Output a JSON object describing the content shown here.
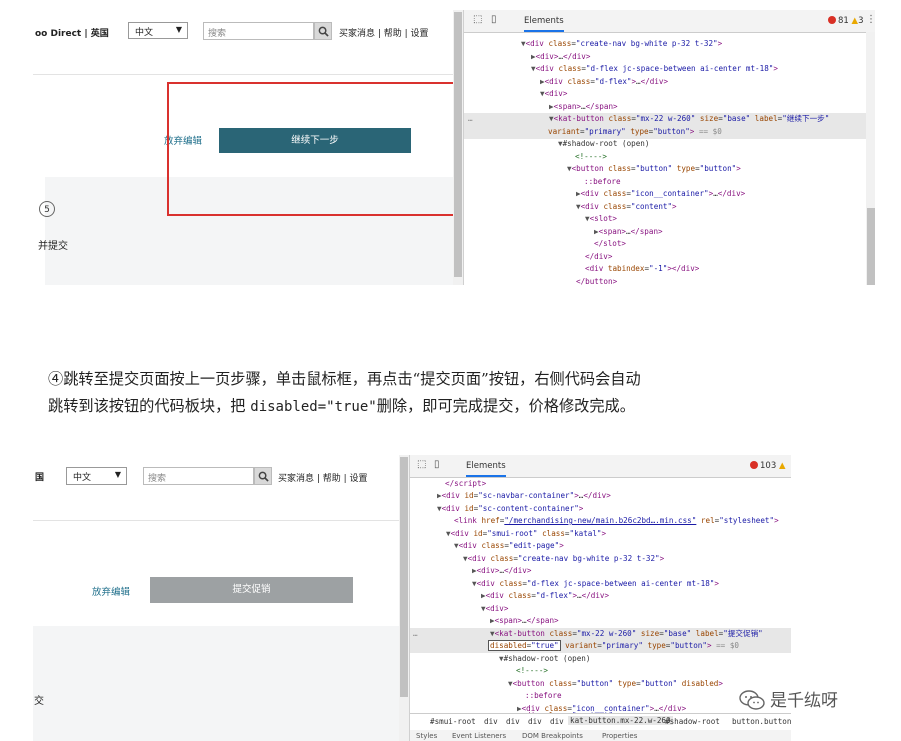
{
  "shot1": {
    "header": {
      "site": "oo Direct | 英国",
      "language": "中文",
      "search_placeholder": "搜索",
      "search_icon": "magnifier-icon",
      "links": "买家消息 | 帮助 | 设置"
    },
    "discard_label": "放弃编辑",
    "continue_label": "继续下一步",
    "step_badge": "5",
    "submit_fragment": "并提交",
    "devtools": {
      "tab": "Elements",
      "error_count": "81",
      "warning_count": "3",
      "close": "×",
      "more": "⋮"
    }
  },
  "shot2": {
    "header": {
      "site": "国",
      "language": "中文",
      "search_placeholder": "搜索",
      "search_icon": "magnifier-icon",
      "links": "买家消息 | 帮助 | 设置"
    },
    "discard_label": "放弃编辑",
    "submit_label": "提交促销",
    "side_fragment": "交",
    "devtools": {
      "tab": "Elements",
      "error_count": "103",
      "breadcrumbs": [
        "#smui-root",
        "div",
        "div",
        "div",
        "div",
        "kat-button.mx-22.w-260",
        "#shadow-root",
        "button.button"
      ],
      "bottom_tabs": [
        "Styles",
        "Event Listeners",
        "DOM Breakpoints",
        "Properties"
      ]
    }
  },
  "paragraph": {
    "line1": "④跳转至提交页面按上一页步骤，单击鼠标框，再点击“提交页面”按钮，右侧代码会自动",
    "line2_a": "跳转到该按钮的代码板块，把 ",
    "line2_code": "disabled=\"true\"",
    "line2_b": "删除，即可完成提交，价格修改完成。"
  },
  "watermark": {
    "text": "是千纮呀",
    "icon": "wechat-icon"
  }
}
